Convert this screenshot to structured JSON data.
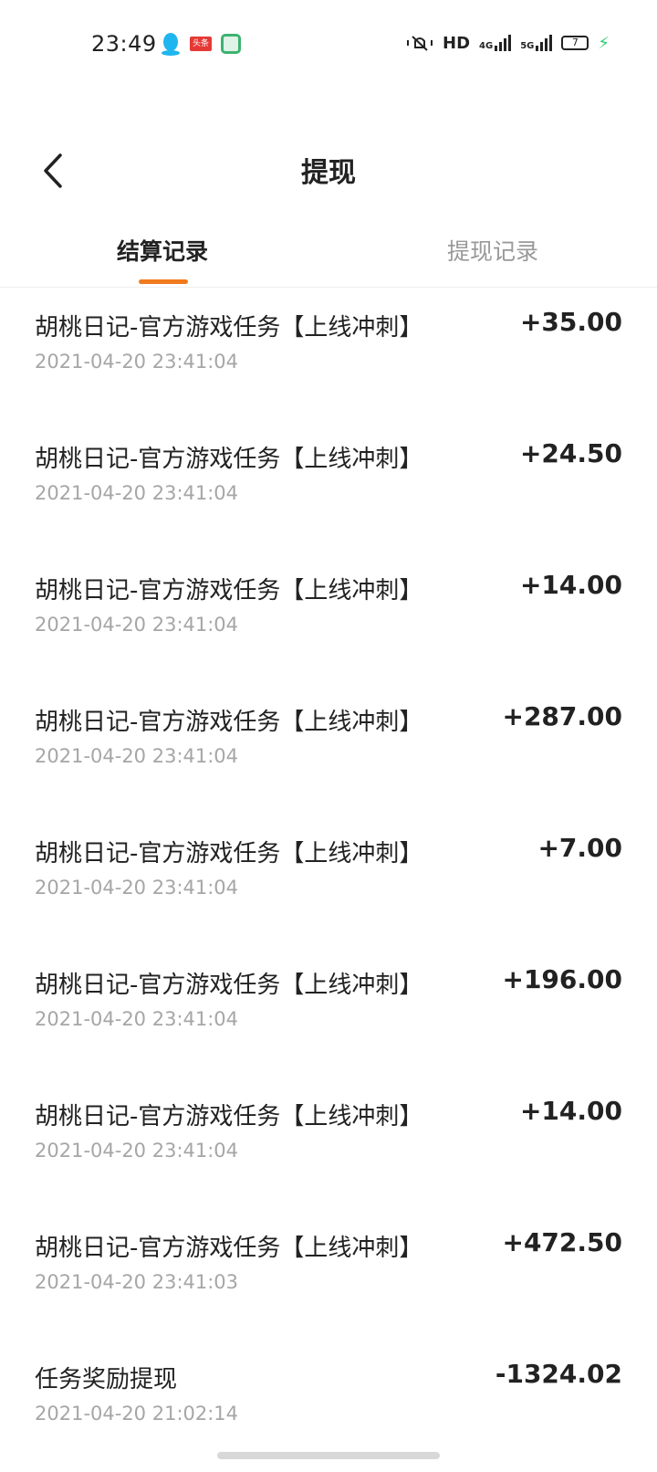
{
  "status_bar": {
    "time": "23:49",
    "toutiao_badge": "头条",
    "hd_label": "HD",
    "net_4g": "4G",
    "net_5g": "5G",
    "battery_level": "7",
    "charging_symbol": "⚡"
  },
  "header": {
    "title": "提现"
  },
  "tabs": [
    {
      "label": "结算记录",
      "active": true
    },
    {
      "label": "提现记录",
      "active": false
    }
  ],
  "records": [
    {
      "title": "胡桃日记-官方游戏任务【上线冲刺】",
      "date": "2021-04-20 23:41:04",
      "amount": "+35.00"
    },
    {
      "title": "胡桃日记-官方游戏任务【上线冲刺】",
      "date": "2021-04-20 23:41:04",
      "amount": "+24.50"
    },
    {
      "title": "胡桃日记-官方游戏任务【上线冲刺】",
      "date": "2021-04-20 23:41:04",
      "amount": "+14.00"
    },
    {
      "title": "胡桃日记-官方游戏任务【上线冲刺】",
      "date": "2021-04-20 23:41:04",
      "amount": "+287.00"
    },
    {
      "title": "胡桃日记-官方游戏任务【上线冲刺】",
      "date": "2021-04-20 23:41:04",
      "amount": "+7.00"
    },
    {
      "title": "胡桃日记-官方游戏任务【上线冲刺】",
      "date": "2021-04-20 23:41:04",
      "amount": "+196.00"
    },
    {
      "title": "胡桃日记-官方游戏任务【上线冲刺】",
      "date": "2021-04-20 23:41:04",
      "amount": "+14.00"
    },
    {
      "title": "胡桃日记-官方游戏任务【上线冲刺】",
      "date": "2021-04-20 23:41:03",
      "amount": "+472.50"
    },
    {
      "title": "任务奖励提现",
      "date": "2021-04-20 21:02:14",
      "amount": "-1324.02"
    }
  ],
  "colors": {
    "accent": "#f07a1e",
    "text_primary": "#222222",
    "text_secondary": "#a6a6a6",
    "tab_inactive": "#999999"
  },
  "icons": {
    "back": "chevron-left-icon",
    "qq": "qq-penguin-icon",
    "app": "app-square-icon",
    "mute": "mute-bell-icon"
  }
}
